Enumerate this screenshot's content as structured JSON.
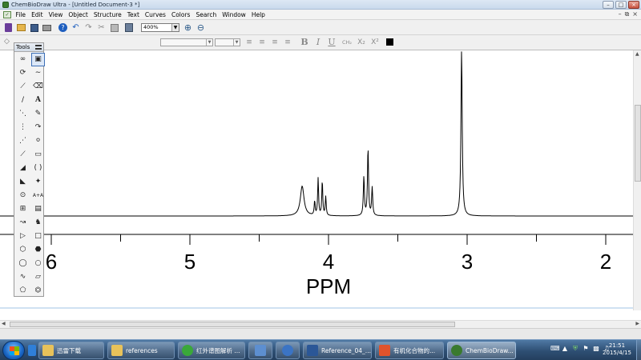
{
  "window": {
    "title": "ChemBioDraw Ultra - [Untitled Document-3 *]"
  },
  "menubar": {
    "items": [
      "File",
      "Edit",
      "View",
      "Object",
      "Structure",
      "Text",
      "Curves",
      "Colors",
      "Search",
      "Window",
      "Help"
    ]
  },
  "toolbar": {
    "zoom_value": "400%",
    "icons": [
      "new-document-icon",
      "open-folder-icon",
      "save-icon",
      "print-icon",
      "help-icon",
      "undo-icon",
      "redo-icon",
      "cut-icon",
      "copy-icon",
      "paste-icon",
      "zoom-in-icon",
      "zoom-out-icon"
    ]
  },
  "text_toolbar": {
    "bold": "B",
    "italic": "I",
    "underline": "U",
    "ch2": "CH₂",
    "subscript": "X₂",
    "superscript": "X²"
  },
  "tools_palette": {
    "title": "Tools"
  },
  "chart_data": {
    "type": "line",
    "title": "",
    "xlabel": "PPM",
    "ylabel": "",
    "xlim": [
      6.05,
      1.95
    ],
    "x_axis_reversed": true,
    "major_ticks": [
      6,
      5,
      4,
      3,
      2
    ],
    "tick_labels": [
      "6",
      "5",
      "4",
      "3",
      "2"
    ],
    "minor_ticks": [
      5.5,
      4.5,
      3.5,
      2.5
    ],
    "grid": false,
    "legend": "none",
    "line_color": "#000000",
    "series": [
      {
        "peaks": [
          {
            "ppm": 4.19,
            "height": 0.18,
            "width": 0.016
          },
          {
            "ppm": 4.1,
            "height": 0.085,
            "width": 0.004
          },
          {
            "ppm": 4.075,
            "height": 0.225,
            "width": 0.004
          },
          {
            "ppm": 4.045,
            "height": 0.21,
            "width": 0.004
          },
          {
            "ppm": 4.02,
            "height": 0.115,
            "width": 0.004
          },
          {
            "ppm": 3.745,
            "height": 0.235,
            "width": 0.0045
          },
          {
            "ppm": 3.715,
            "height": 0.41,
            "width": 0.0045
          },
          {
            "ppm": 3.685,
            "height": 0.17,
            "width": 0.0045
          },
          {
            "ppm": 3.04,
            "height": 1.0,
            "width": 0.0055
          }
        ]
      }
    ]
  },
  "taskbar": {
    "items": [
      {
        "label": "",
        "icon": "ie-icon"
      },
      {
        "label": "迅雷下载",
        "icon": "folder-icon"
      },
      {
        "label": "references",
        "icon": "folder-icon"
      },
      {
        "label": "红外谱图解析 ...",
        "icon": "browser-icon"
      },
      {
        "label": "",
        "icon": "app-window-icon"
      },
      {
        "label": "",
        "icon": "globe-icon"
      },
      {
        "label": "Reference_04_...",
        "icon": "word-document-icon"
      },
      {
        "label": "有机化合物的...",
        "icon": "red-app-icon"
      },
      {
        "label": "ChemBioDraw...",
        "icon": "chemdraw-icon"
      }
    ],
    "clock_time": "21:51",
    "clock_date": "2015/4/15"
  }
}
